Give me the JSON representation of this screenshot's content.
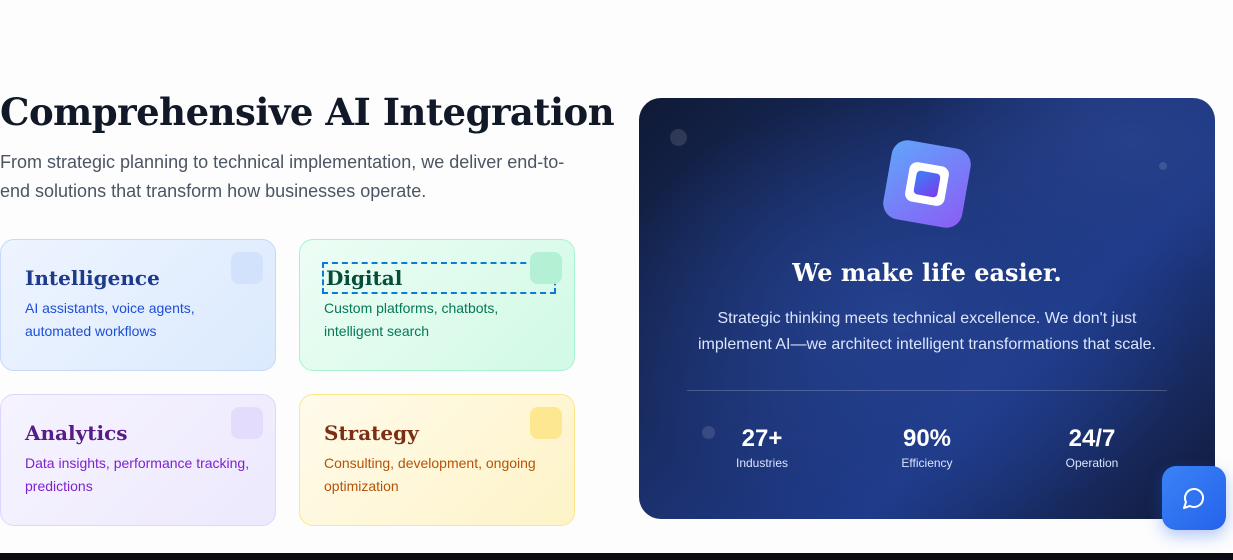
{
  "section": {
    "title": "Comprehensive AI Integration",
    "subtitle": "From strategic planning to technical implementation, we deliver end-to-end solutions that transform how businesses operate."
  },
  "cards": [
    {
      "title": "Intelligence",
      "description": "AI assistants, voice agents, automated workflows"
    },
    {
      "title": "Digital",
      "description": "Custom platforms, chatbots, intelligent search"
    },
    {
      "title": "Analytics",
      "description": "Data insights, performance tracking, predictions"
    },
    {
      "title": "Strategy",
      "description": "Consulting, development, ongoing optimization"
    }
  ],
  "panel": {
    "title": "We make life easier.",
    "text": "Strategic thinking meets technical excellence. We don't just implement AI—we architect intelligent transformations that scale.",
    "stats": [
      {
        "value": "27+",
        "label": "Industries"
      },
      {
        "value": "90%",
        "label": "Efficiency"
      },
      {
        "value": "24/7",
        "label": "Operation"
      }
    ]
  },
  "icons": {
    "chat": "chat-bubble-icon",
    "logo": "app-logo-icon"
  },
  "colors": {
    "accent": "#2563eb",
    "panel_dark": "#0f1a35",
    "panel_blue": "#1e3a8a"
  }
}
